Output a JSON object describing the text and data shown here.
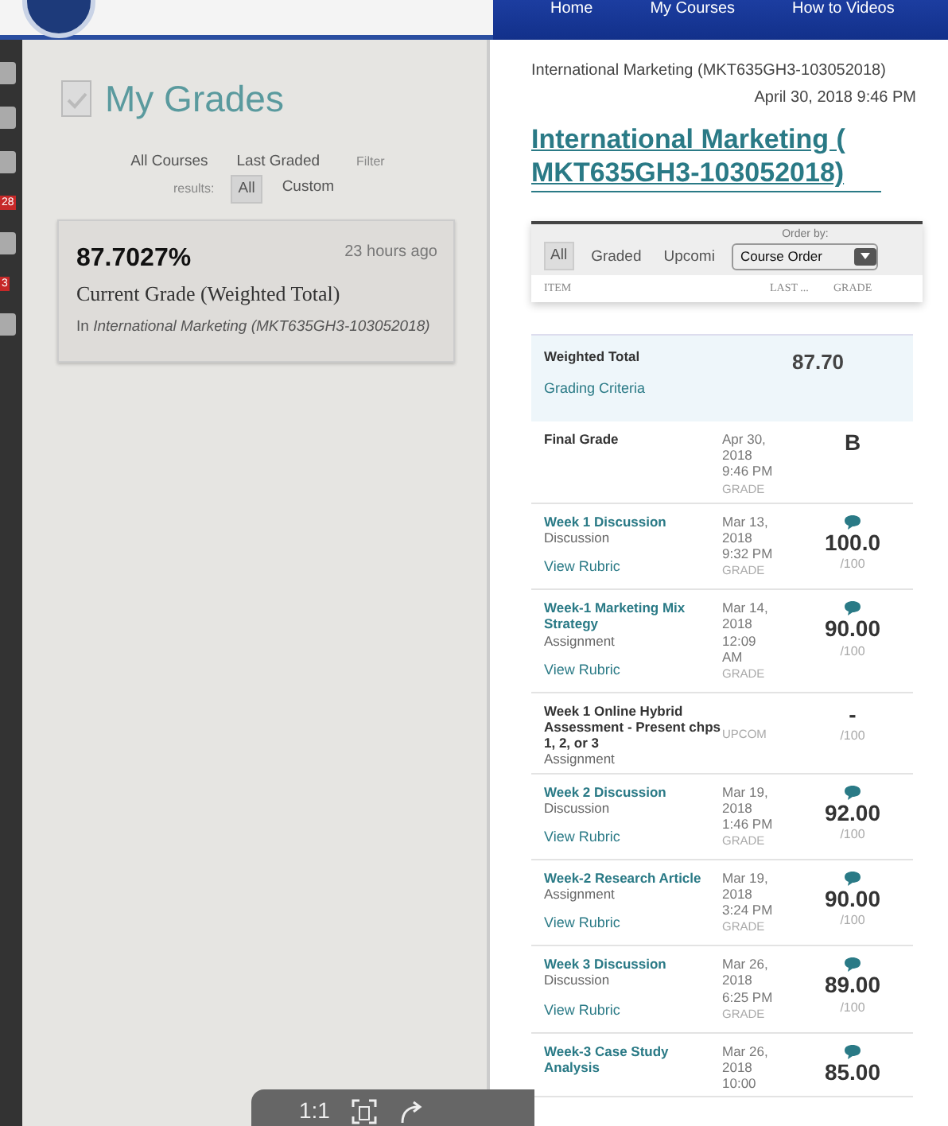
{
  "top_nav": {
    "items": [
      {
        "label": "Home"
      },
      {
        "label": "My Courses"
      },
      {
        "label": "How to Videos"
      }
    ]
  },
  "sidebar": {
    "badges": [
      "28",
      "3"
    ]
  },
  "my_grades": {
    "title": "My Grades",
    "filter_row_1": [
      {
        "label": "All Courses",
        "selected": false
      },
      {
        "label": "Last Graded",
        "selected": false
      }
    ],
    "filter_label": "Filter",
    "results_label": "results:",
    "filter_row_2": [
      {
        "label": "All",
        "selected": true
      },
      {
        "label": "Custom",
        "selected": false
      }
    ],
    "card": {
      "percent": "87.7027%",
      "time": "23 hours ago",
      "caption": "Current Grade (Weighted Total)",
      "course": "In *International Marketing (MKT635GH3-103052018)*"
    }
  },
  "detail": {
    "breadcrumb": "International Marketing (MKT635GH3-103052018)",
    "date": "April 30, 2018 9:46 PM",
    "heading": "International Marketing ( MKT635GH3-103052018)",
    "tabs": [
      {
        "label": "All",
        "selected": true
      },
      {
        "label": "Graded",
        "selected": false
      },
      {
        "label": "Upcomi",
        "selected": false
      }
    ],
    "order_by_label": "Order by:",
    "order_by_value": "Course Order",
    "columns": [
      "ITEM",
      "LAST ...",
      "GRADE"
    ],
    "total": {
      "label": "Weighted Total",
      "link": "Grading Criteria",
      "grade": "87.70"
    },
    "rows": [
      {
        "title": "Final Grade",
        "linked": false,
        "type": "",
        "rubric": "",
        "date": "Apr 30, 2018 9:46 PM",
        "status": "GRADE",
        "grade": "B",
        "out_of": "",
        "feedback": false
      },
      {
        "title": "Week 1 Discussion",
        "linked": true,
        "type": "Discussion",
        "rubric": "View Rubric",
        "date": "Mar 13, 2018 9:32 PM",
        "status": "GRADE",
        "grade": "100.0",
        "out_of": "/100",
        "feedback": true
      },
      {
        "title": "Week-1 Marketing Mix Strategy",
        "linked": true,
        "type": "Assignment",
        "rubric": "View Rubric",
        "date": "Mar 14, 2018 12:09 AM",
        "status": "GRADE",
        "grade": "90.00",
        "out_of": "/100",
        "feedback": true
      },
      {
        "title": "Week 1 Online Hybrid Assessment - Present chps 1, 2, or 3",
        "linked": false,
        "type": "Assignment",
        "rubric": "",
        "date": "",
        "status": "UPCOM",
        "grade": "-",
        "out_of": "/100",
        "feedback": false
      },
      {
        "title": "Week 2 Discussion",
        "linked": true,
        "type": "Discussion",
        "rubric": "View Rubric",
        "date": "Mar 19, 2018 1:46 PM",
        "status": "GRADE",
        "grade": "92.00",
        "out_of": "/100",
        "feedback": true
      },
      {
        "title": "Week-2 Research Article",
        "linked": true,
        "type": "Assignment",
        "rubric": "View Rubric",
        "date": "Mar 19, 2018 3:24 PM",
        "status": "GRADE",
        "grade": "90.00",
        "out_of": "/100",
        "feedback": true
      },
      {
        "title": "Week 3 Discussion",
        "linked": true,
        "type": "Discussion",
        "rubric": "View Rubric",
        "date": "Mar 26, 2018 6:25 PM",
        "status": "GRADE",
        "grade": "89.00",
        "out_of": "/100",
        "feedback": true
      },
      {
        "title": "Week-3 Case Study Analysis",
        "linked": true,
        "type": "",
        "rubric": "",
        "date": "Mar 26, 2018 10:00",
        "status": "",
        "grade": "85.00",
        "out_of": "",
        "feedback": true
      }
    ]
  },
  "viewer_toolbar": {
    "zoom_label": "1:1"
  }
}
